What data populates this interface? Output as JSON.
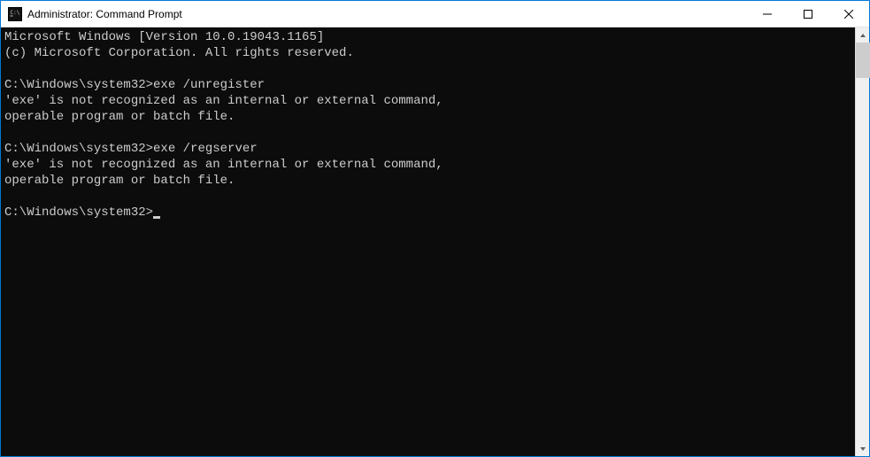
{
  "titlebar": {
    "title": "Administrator: Command Prompt",
    "icon": "cmd-icon"
  },
  "console": {
    "banner_line1": "Microsoft Windows [Version 10.0.19043.1165]",
    "banner_line2": "(c) Microsoft Corporation. All rights reserved.",
    "prompt": "C:\\Windows\\system32>",
    "entries": [
      {
        "command": "exe /unregister",
        "output_line1": "'exe' is not recognized as an internal or external command,",
        "output_line2": "operable program or batch file."
      },
      {
        "command": "exe /regserver",
        "output_line1": "'exe' is not recognized as an internal or external command,",
        "output_line2": "operable program or batch file."
      }
    ]
  }
}
